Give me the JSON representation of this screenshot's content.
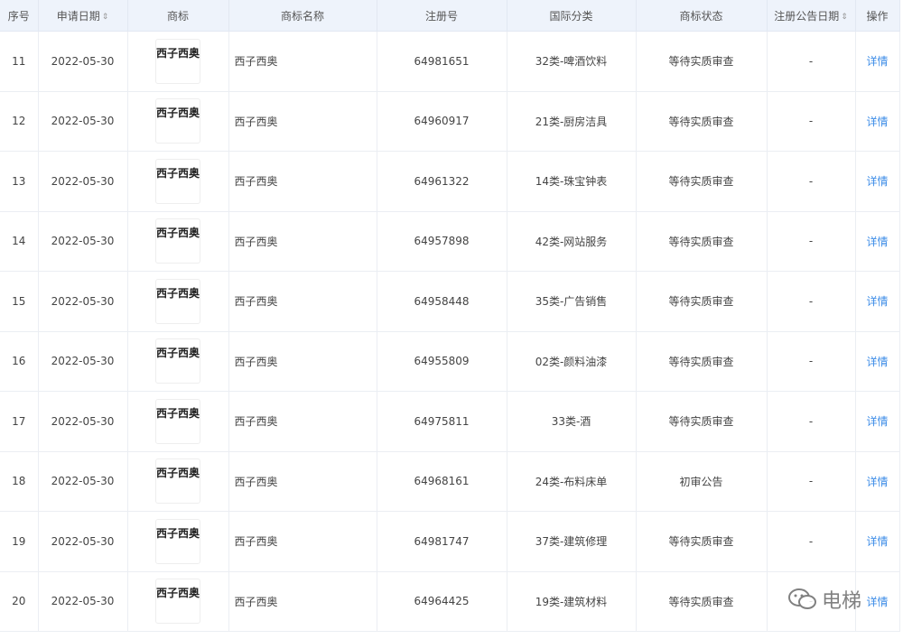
{
  "headers": {
    "index": "序号",
    "apply_date": "申请日期",
    "logo": "商标",
    "name": "商标名称",
    "reg_no": "注册号",
    "class": "国际分类",
    "status": "商标状态",
    "pub_date": "注册公告日期",
    "action": "操作"
  },
  "sort_glyph": "⇕",
  "rows": [
    {
      "index": "11",
      "date": "2022-05-30",
      "logo": "西子西奥",
      "name": "西子西奥",
      "reg_no": "64981651",
      "class": "32类-啤酒饮料",
      "status": "等待实质审查",
      "pub": "-",
      "action": "详情"
    },
    {
      "index": "12",
      "date": "2022-05-30",
      "logo": "西子西奥",
      "name": "西子西奥",
      "reg_no": "64960917",
      "class": "21类-厨房洁具",
      "status": "等待实质审查",
      "pub": "-",
      "action": "详情"
    },
    {
      "index": "13",
      "date": "2022-05-30",
      "logo": "西子西奥",
      "name": "西子西奥",
      "reg_no": "64961322",
      "class": "14类-珠宝钟表",
      "status": "等待实质审查",
      "pub": "-",
      "action": "详情"
    },
    {
      "index": "14",
      "date": "2022-05-30",
      "logo": "西子西奥",
      "name": "西子西奥",
      "reg_no": "64957898",
      "class": "42类-网站服务",
      "status": "等待实质审查",
      "pub": "-",
      "action": "详情"
    },
    {
      "index": "15",
      "date": "2022-05-30",
      "logo": "西子西奥",
      "name": "西子西奥",
      "reg_no": "64958448",
      "class": "35类-广告销售",
      "status": "等待实质审查",
      "pub": "-",
      "action": "详情"
    },
    {
      "index": "16",
      "date": "2022-05-30",
      "logo": "西子西奥",
      "name": "西子西奥",
      "reg_no": "64955809",
      "class": "02类-颜料油漆",
      "status": "等待实质审查",
      "pub": "-",
      "action": "详情"
    },
    {
      "index": "17",
      "date": "2022-05-30",
      "logo": "西子西奥",
      "name": "西子西奥",
      "reg_no": "64975811",
      "class": "33类-酒",
      "status": "等待实质审查",
      "pub": "-",
      "action": "详情"
    },
    {
      "index": "18",
      "date": "2022-05-30",
      "logo": "西子西奥",
      "name": "西子西奥",
      "reg_no": "64968161",
      "class": "24类-布料床单",
      "status": "初审公告",
      "pub": "-",
      "action": "详情"
    },
    {
      "index": "19",
      "date": "2022-05-30",
      "logo": "西子西奥",
      "name": "西子西奥",
      "reg_no": "64981747",
      "class": "37类-建筑修理",
      "status": "等待实质审查",
      "pub": "-",
      "action": "详情"
    },
    {
      "index": "20",
      "date": "2022-05-30",
      "logo": "西子西奥",
      "name": "西子西奥",
      "reg_no": "64964425",
      "class": "19类-建筑材料",
      "status": "等待实质审查",
      "pub": "-",
      "action": "详情"
    }
  ],
  "watermark": {
    "text": "电梯",
    "icon": "wechat-icon"
  },
  "colors": {
    "link": "#3c8ce7",
    "header_bg": "#eef3fb"
  }
}
